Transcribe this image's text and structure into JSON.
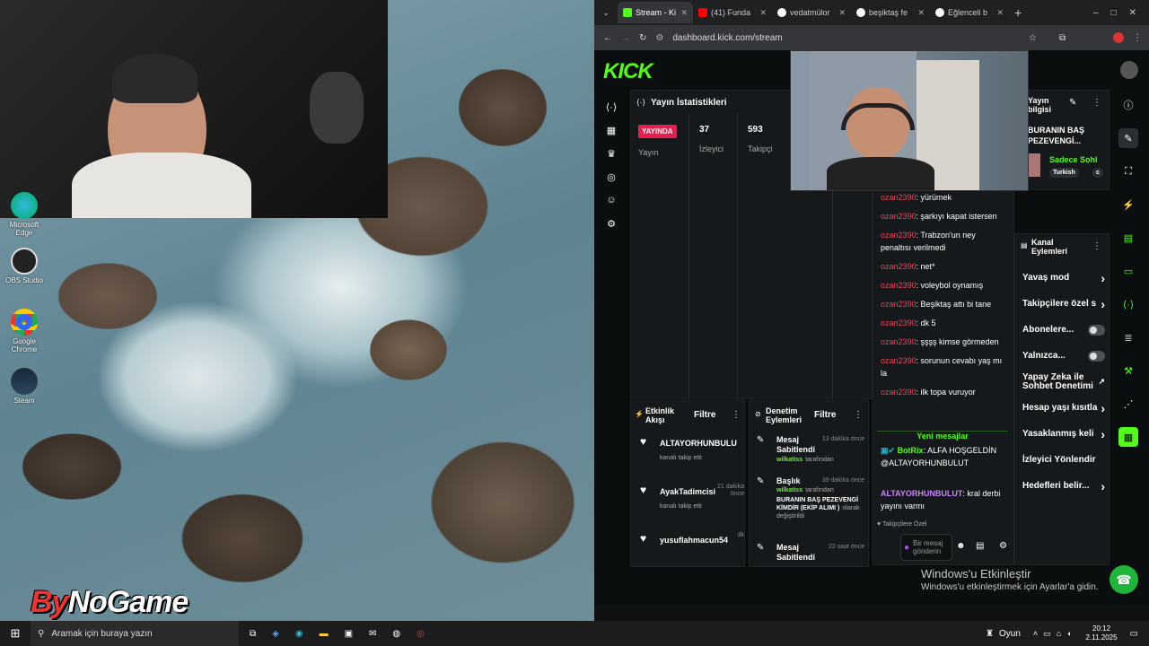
{
  "desktop": {
    "icons": [
      {
        "label": "Microsoft Edge",
        "icon": "edge-icon"
      },
      {
        "label": "OBS Studio",
        "icon": "obs-icon"
      },
      {
        "label": "Google Chrome",
        "icon": "chrome-icon"
      },
      {
        "label": "Steam",
        "icon": "steam-icon"
      }
    ],
    "logo_a": "By",
    "logo_b": "NoGame"
  },
  "browser": {
    "tabs": [
      {
        "label": "Stream - Ki",
        "icon": "kick-icon",
        "active": true
      },
      {
        "label": "(41) Funda",
        "icon": "youtube-icon"
      },
      {
        "label": "vedatmülor",
        "icon": "globe-icon"
      },
      {
        "label": "beşiktaş fe",
        "icon": "globe-icon"
      },
      {
        "label": "Eğlenceli b",
        "icon": "globe-icon"
      }
    ],
    "url": "dashboard.kick.com/stream"
  },
  "kick": {
    "logo": "KICK",
    "stats": {
      "title": "Yayın İstatistikleri",
      "live_badge": "YAYINDA",
      "live_label": "Yayın",
      "viewers_value": "37",
      "viewers_label": "İzleyici",
      "followers_value": "593",
      "followers_label": "Takipçi"
    },
    "stream_info": {
      "title": "Yayın bilgisi",
      "stream_title": "BURANIN BAŞ PEZEVENGİ...",
      "category": "Sadece Sohl",
      "language": "Turkish",
      "tag": "c"
    },
    "chat": {
      "lines": [
        {
          "user": "ozan2390",
          "text": ": yürümek"
        },
        {
          "user": "ozan2390",
          "text": ": şarkıyı kapat istersen"
        },
        {
          "user": "ozan2390",
          "text": ": Trabzon'un ney penaltısı verilmedi"
        },
        {
          "user": "ozan2390",
          "text": ": net*"
        },
        {
          "user": "ozan2390",
          "text": ": voleybol oynamış"
        },
        {
          "user": "ozan2390",
          "text": ": Beşiktaş attı bi tane"
        },
        {
          "user": "ozan2390",
          "text": ": dk 5"
        },
        {
          "user": "ozan2390",
          "text": ": şşşş kimse görmeden"
        },
        {
          "user": "ozan2390",
          "text": ": sorunun cevabı yaş mı la"
        },
        {
          "user": "ozan2390",
          "text": ": ilk topa vuruyor"
        }
      ],
      "new_messages": "Yeni mesajlar",
      "bot_user": "BotRix",
      "bot_text": ": ALFA HOŞGELDİN @ALTAYORHUNBULUT",
      "last_user": "ALTAYORHUNBULUT",
      "last_text": ": kral derbi yayını varmı",
      "followers_only": "Takipçilere Özel",
      "input_placeholder": "Bir mesaj gönderin"
    },
    "channel_actions": {
      "title": "Kanal Eylemleri",
      "items": [
        {
          "label": "Yavaş mod",
          "control": "arrow"
        },
        {
          "label": "Takipçilere özel s",
          "control": "arrow"
        },
        {
          "label": "Abonelere...",
          "control": "toggle"
        },
        {
          "label": "Yalnızca...",
          "control": "toggle"
        },
        {
          "label": "Yapay Zeka ile Sohbet Denetimi",
          "control": "external"
        },
        {
          "label": "Hesap yaşı kısıtla",
          "control": "arrow"
        },
        {
          "label": "Yasaklanmış keli",
          "control": "arrow"
        },
        {
          "label": "İzleyici Yönlendir",
          "control": "none"
        },
        {
          "label": "Hedefleri belir...",
          "control": "arrow"
        }
      ]
    },
    "activity": {
      "title": "Etkinlik Akışı",
      "filter": "Filtre",
      "items": [
        {
          "user": "ALTAYORHUNBULU",
          "sub": "kanalı takip etti",
          "time": ""
        },
        {
          "user": "AyakTadimcisi",
          "sub": "kanalı takip etti",
          "time": "21 dakika önce"
        },
        {
          "user": "yusuflahmacun54",
          "sub": "",
          "time": "dk"
        }
      ]
    },
    "moderation": {
      "title": "Denetim Eylemleri",
      "filter": "Filtre",
      "items": [
        {
          "action": "Mesaj Sabitlendi",
          "time": "13 dakika önce",
          "by": "wilkatiss",
          "by_suffix": "tarafından",
          "detail": ""
        },
        {
          "action": "Başlık",
          "time": "39 dakika önce",
          "by": "wilkatiss",
          "by_suffix": "tarafından",
          "detail": "BURANIN BAŞ PEZEVENGİ KİMDİR (EKİP ALIMI )",
          "detail_suffix": "olarak değiştirildi"
        },
        {
          "action": "Mesaj Sabitlendi",
          "time": "22 saat önce",
          "by": "",
          "by_suffix": "",
          "detail": ""
        }
      ]
    }
  },
  "windows": {
    "activation_title": "Windows'u Etkinleştir",
    "activation_sub": "Windows'u etkinleştirmek için Ayarlar'a gidin."
  },
  "taskbar": {
    "search_placeholder": "Aramak için buraya yazın",
    "game_label": "Oyun",
    "time": "20:12",
    "date": "2.11.2025"
  },
  "colors": {
    "kick_green": "#53fc18",
    "live_red": "#e91e4c",
    "chat_user": "#e8465a",
    "mod_user": "#53fc18",
    "alt_user": "#c883ff"
  }
}
